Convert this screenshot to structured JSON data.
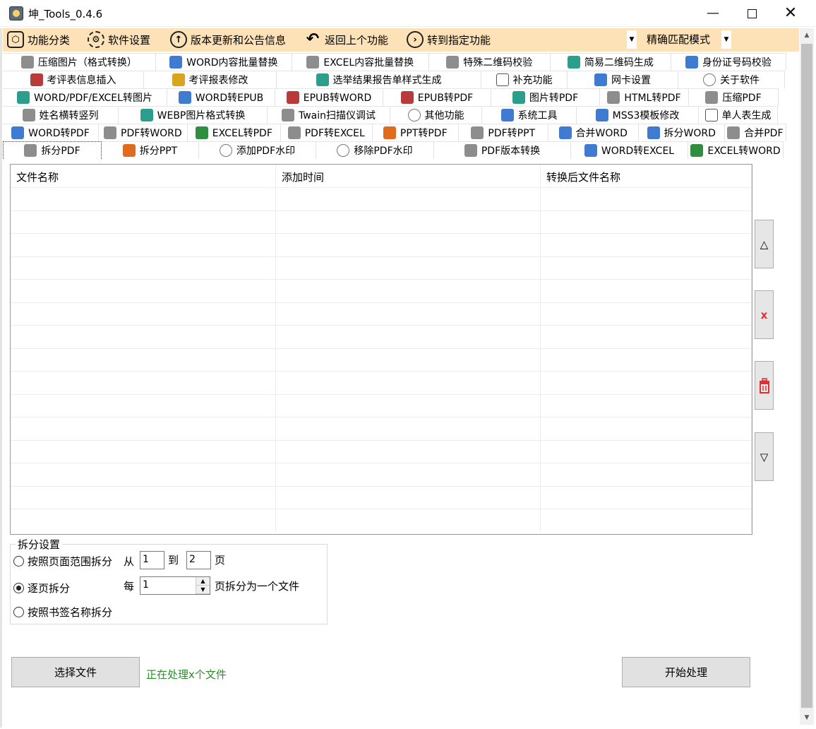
{
  "window": {
    "title": "坤_Tools_0.4.6",
    "min": "—",
    "close": "✕"
  },
  "toolbar": {
    "items": [
      {
        "label": "功能分类",
        "icon": "cube-icon",
        "glyph": "⬡"
      },
      {
        "label": "软件设置",
        "icon": "gear-icon",
        "glyph": "⚙"
      },
      {
        "label": "版本更新和公告信息",
        "icon": "arrow-up-circle-icon",
        "glyph": "↑"
      },
      {
        "label": "返回上个功能",
        "icon": "back-arrow-icon",
        "glyph": "↶"
      },
      {
        "label": "转到指定功能",
        "icon": "arrow-right-circle-icon",
        "glyph": "›"
      }
    ],
    "mode_value": "精确匹配模式",
    "combo_arrow": "▼"
  },
  "tabs": {
    "row1": [
      {
        "label": "压缩图片（格式转换）",
        "icon": "gray"
      },
      {
        "label": "WORD内容批量替换",
        "icon": "blue"
      },
      {
        "label": "EXCEL内容批量替换",
        "icon": "gray"
      },
      {
        "label": "特殊二维码校验",
        "icon": "gray"
      },
      {
        "label": "简易二维码生成",
        "icon": "teal"
      },
      {
        "label": "身份证号码校验",
        "icon": "blue"
      }
    ],
    "row2": [
      {
        "label": "考评表信息插入",
        "icon": "red"
      },
      {
        "label": "考评报表修改",
        "icon": "yellow"
      },
      {
        "label": "选举结果报告单样式生成",
        "icon": "teal"
      },
      {
        "label": "补充功能",
        "icon": "doc"
      },
      {
        "label": "网卡设置",
        "icon": "blue"
      },
      {
        "label": "关于软件",
        "icon": "circle"
      }
    ],
    "row3": [
      {
        "label": "WORD/PDF/EXCEL转图片",
        "icon": "teal"
      },
      {
        "label": "WORD转EPUB",
        "icon": "blue"
      },
      {
        "label": "EPUB转WORD",
        "icon": "red"
      },
      {
        "label": "EPUB转PDF",
        "icon": "red"
      },
      {
        "label": "图片转PDF",
        "icon": "teal"
      },
      {
        "label": "HTML转PDF",
        "icon": "gray"
      },
      {
        "label": "压缩PDF",
        "icon": "gray"
      }
    ],
    "row4": [
      {
        "label": "姓名横转竖列",
        "icon": "gray"
      },
      {
        "label": "WEBP图片格式转换",
        "icon": "teal"
      },
      {
        "label": "Twain扫描仪调试",
        "icon": "gray"
      },
      {
        "label": "其他功能",
        "icon": "circle"
      },
      {
        "label": "系统工具",
        "icon": "blue"
      },
      {
        "label": "MSS3模板修改",
        "icon": "blue"
      },
      {
        "label": "单人表生成",
        "icon": "doc"
      }
    ],
    "row5": [
      {
        "label": "WORD转PDF",
        "icon": "blue"
      },
      {
        "label": "PDF转WORD",
        "icon": "gray"
      },
      {
        "label": "EXCEL转PDF",
        "icon": "green"
      },
      {
        "label": "PDF转EXCEL",
        "icon": "gray"
      },
      {
        "label": "PPT转PDF",
        "icon": "orange"
      },
      {
        "label": "PDF转PPT",
        "icon": "gray"
      },
      {
        "label": "合并WORD",
        "icon": "blue"
      },
      {
        "label": "拆分WORD",
        "icon": "blue"
      },
      {
        "label": "合并PDF",
        "icon": "gray"
      }
    ],
    "row6": [
      {
        "label": "拆分PDF",
        "icon": "gray",
        "active": true
      },
      {
        "label": "拆分PPT",
        "icon": "orange"
      },
      {
        "label": "添加PDF水印",
        "icon": "circle"
      },
      {
        "label": "移除PDF水印",
        "icon": "circle"
      },
      {
        "label": "PDF版本转换",
        "icon": "gray"
      },
      {
        "label": "WORD转EXCEL",
        "icon": "blue"
      },
      {
        "label": "EXCEL转WORD",
        "icon": "green"
      }
    ]
  },
  "table": {
    "columns": [
      "文件名称",
      "添加时间",
      "转换后文件名称"
    ],
    "rows": []
  },
  "side_buttons": {
    "up": "△",
    "remove": "x",
    "clear_icon": "trash-icon",
    "down": "▽"
  },
  "split_settings": {
    "title": "拆分设置",
    "options": [
      {
        "label": "按照页面范围拆分",
        "checked": false
      },
      {
        "label": "逐页拆分",
        "checked": true
      },
      {
        "label": "按照书签名称拆分",
        "checked": false
      }
    ],
    "from_label": "从",
    "to_label": "到",
    "page_label": "页",
    "from_value": "1",
    "to_value": "2",
    "every_label": "每",
    "every_value": "1",
    "every_suffix": "页拆分为一个文件",
    "spin_up": "▲",
    "spin_down": "▼"
  },
  "actions": {
    "select_files": "选择文件",
    "status": "正在处理x个文件",
    "start": "开始处理"
  },
  "scrollbar": {
    "up": "▲",
    "down": "▼"
  }
}
